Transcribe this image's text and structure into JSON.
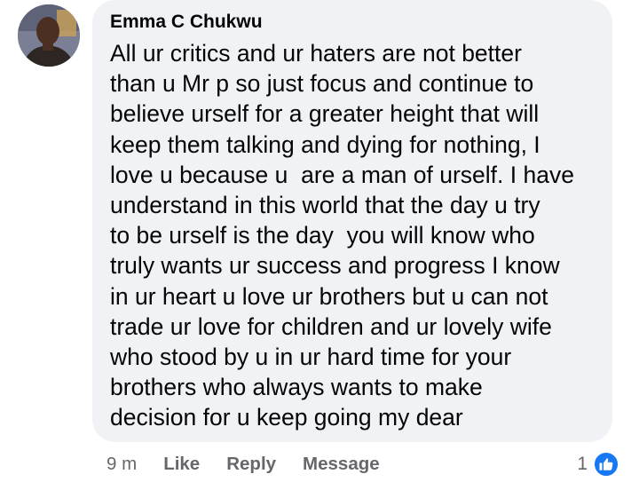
{
  "comment": {
    "author": "Emma C Chukwu",
    "lines": [
      "All ur critics and ur haters are not better",
      "than u Mr p so just focus and continue to",
      "believe urself for a greater height that will",
      "keep them talking and dying for nothing, I",
      "love u because u  are a man of urself. I have",
      "understand in this world that the day u try",
      "to be urself is the day  you will know who",
      "truly wants ur success and progress I know",
      "in ur heart u love ur brothers but u can not",
      "trade ur love for children and ur lovely wife",
      "who stood by u in ur hard time for your",
      "brothers who always wants to make",
      "decision for u keep going my dear"
    ]
  },
  "actions": {
    "time": "9 m",
    "like_label": "Like",
    "reply_label": "Reply",
    "message_label": "Message"
  },
  "reactions": {
    "count": "1",
    "icon": "like-icon",
    "color": "#1877f2"
  }
}
